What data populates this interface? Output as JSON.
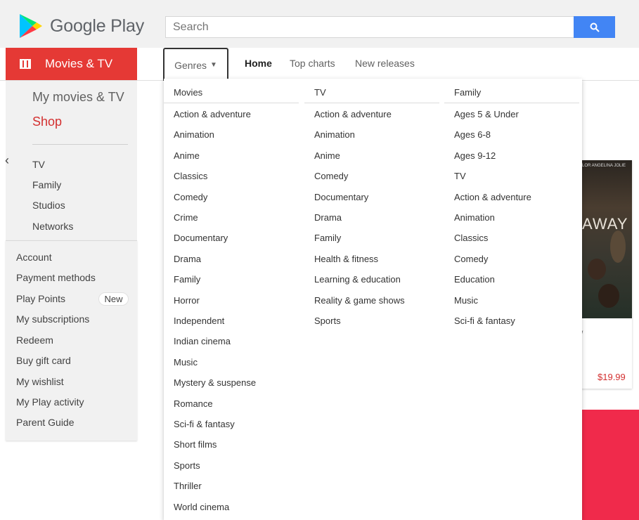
{
  "header": {
    "logo_text": "Google Play",
    "search_placeholder": "Search"
  },
  "subnav": {
    "section_label": "Movies & TV",
    "genres_label": "Genres",
    "links": [
      "Home",
      "Top charts",
      "New releases"
    ]
  },
  "sidebar": {
    "my_movies": "My movies & TV",
    "shop": "Shop",
    "categories": [
      "TV",
      "Family",
      "Studios",
      "Networks"
    ],
    "account_items": [
      "Account",
      "Payment methods",
      "Play Points",
      "My subscriptions",
      "Redeem",
      "Buy gift card",
      "My wishlist",
      "My Play activity",
      "Parent Guide"
    ],
    "play_points_badge": "New"
  },
  "dropdown": {
    "columns": [
      {
        "heading": "Movies",
        "items": [
          "Action & adventure",
          "Animation",
          "Anime",
          "Classics",
          "Comedy",
          "Crime",
          "Documentary",
          "Drama",
          "Family",
          "Horror",
          "Independent",
          "Indian cinema",
          "Music",
          "Mystery & suspense",
          "Romance",
          "Sci-fi & fantasy",
          "Short films",
          "Sports",
          "Thriller",
          "World cinema"
        ]
      },
      {
        "heading": "TV",
        "items": [
          "Action & adventure",
          "Animation",
          "Anime",
          "Comedy",
          "Documentary",
          "Drama",
          "Family",
          "Health & fitness",
          "Learning & education",
          "Reality & game shows",
          "Sports"
        ]
      },
      {
        "heading": "Family",
        "items": [
          "Ages 5 & Under",
          "Ages 6-8",
          "Ages 9-12",
          "TV",
          "Action & adventure",
          "Animation",
          "Classics",
          "Comedy",
          "Education",
          "Music",
          "Sci-fi & fantasy"
        ]
      }
    ]
  },
  "background_card": {
    "poster_top_text": "LOR ANGELINA JOLIE",
    "poster_title": "AWAY",
    "subtitle_fragment": "/",
    "price": "$19.99"
  },
  "colors": {
    "brand_red": "#e53935",
    "search_blue": "#4285f4",
    "price_red": "#d32f2f"
  }
}
